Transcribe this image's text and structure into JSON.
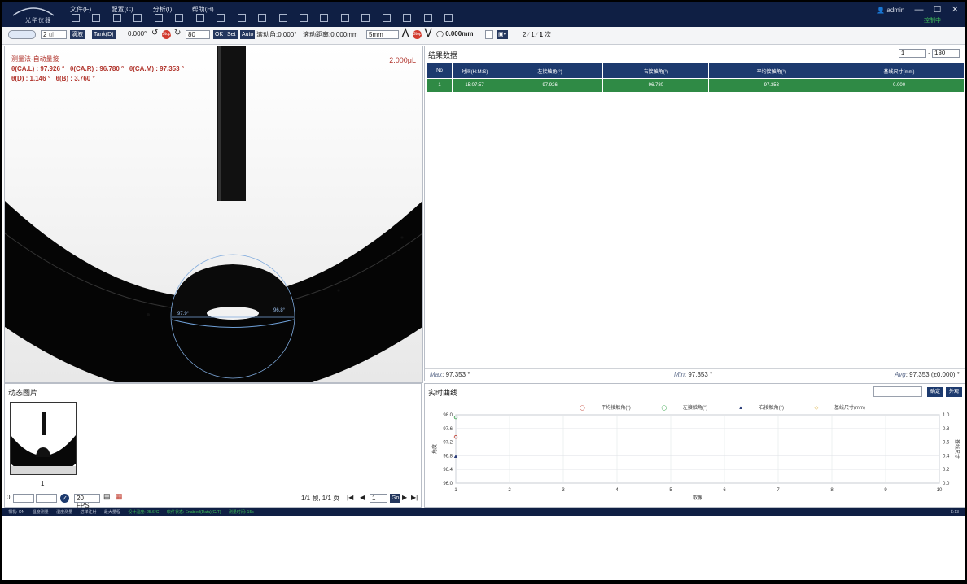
{
  "titlebar": {
    "logo_text": "光华仪器",
    "menu": [
      "文件(F)",
      "配置(C)",
      "分析(I)",
      "帮助(H)"
    ],
    "user": "admin",
    "status": "控制中"
  },
  "toolbar": {
    "step_value": "2",
    "unit": "ul",
    "mode_select": "滴液",
    "method_select": "Tank(D)",
    "angle_readout": "0.000°",
    "speed_value": "80",
    "btn_ok": "OK",
    "btn_set": "Set",
    "btn_auto": "Auto",
    "tilt_label": "滚动角:0.000°",
    "move_label": "滚动距离:0.000mm",
    "pos_unit": "5mm",
    "position_readout": "0.000mm",
    "count_a": "2",
    "count_b": "1",
    "count_times": "1",
    "times_label": "次"
  },
  "image_panel": {
    "method_label": "测量法-自动量接",
    "ca_l": "θ(CA.L) : 97.926 °",
    "ca_r": "θ(CA.R) : 96.780 °",
    "ca_m": "θ(CA.M) : 97.353 °",
    "theta_d": "θ(D) : 1.146 °",
    "theta_b": "θ(B) : 3.760 °",
    "volume": "2.000μL",
    "left_angle_tag": "97.9°",
    "right_angle_tag": "96.8°"
  },
  "results": {
    "title": "结果数据",
    "range_from": "1",
    "range_to": "180",
    "columns": [
      "No",
      "时间(H:M:S)",
      "左接触角(°)",
      "右接触角(°)",
      "平均接触角(°)",
      "基线尺寸(mm)"
    ],
    "rows": [
      [
        "1",
        "15:07:57",
        "97.926",
        "96.780",
        "97.353",
        "0.000"
      ]
    ],
    "stats": {
      "max_label": "Max",
      "max_value": "97.353 °",
      "min_label": "Min",
      "min_value": "97.353 °",
      "avg_label": "Avg",
      "avg_value": "97.353 (±0.000) °"
    }
  },
  "dynamic": {
    "title": "动态图片",
    "thumb_label": "1",
    "frame_from": "0",
    "fps": "20 FPS",
    "page_info": "1/1 帧, 1/1 页",
    "page_input": "1",
    "go_label": "Go"
  },
  "curve": {
    "title": "实时曲线",
    "btn_a": "确定",
    "btn_b": "外观",
    "legend": [
      "平均接触角(°)",
      "左接触角(°)",
      "右接触角(°)",
      "基线尺寸(mm)"
    ],
    "legend_colors": [
      "#c0392b",
      "#2ea043",
      "#2c3e7a",
      "#d4a017"
    ],
    "y_left_label": "角度",
    "y_right_label": "基线尺寸",
    "x_label": "取像"
  },
  "chart_data": {
    "type": "line",
    "xlim": [
      1,
      10
    ],
    "ylim": [
      96.0,
      98.0
    ],
    "y2lim": [
      0.0,
      1.0
    ],
    "x_ticks": [
      "1",
      "2",
      "3",
      "4",
      "5",
      "6",
      "7",
      "8",
      "9",
      "10"
    ],
    "y_ticks": [
      "98.0",
      "97.6",
      "97.2",
      "96.8",
      "96.4",
      "96.0"
    ],
    "y2_ticks": [
      "1.0",
      "0.8",
      "0.6",
      "0.4",
      "0.2",
      "0.0"
    ],
    "series": [
      {
        "name": "平均接触角(°)",
        "x": [
          1
        ],
        "values": [
          97.353
        ],
        "color": "#c0392b"
      },
      {
        "name": "左接触角(°)",
        "x": [
          1
        ],
        "values": [
          97.926
        ],
        "color": "#2ea043"
      },
      {
        "name": "右接触角(°)",
        "x": [
          1
        ],
        "values": [
          96.78
        ],
        "color": "#2c3e7a"
      }
    ],
    "grid": true
  },
  "statusbar": {
    "items": [
      "相机: ON",
      "温度测量",
      "湿度测量",
      "进样注射",
      "最大量程",
      "设计温度: 25.6°C",
      "软件状态: Enabled(Data)(G/T)",
      "测量时间: 15s"
    ],
    "right": "Ē:13"
  }
}
